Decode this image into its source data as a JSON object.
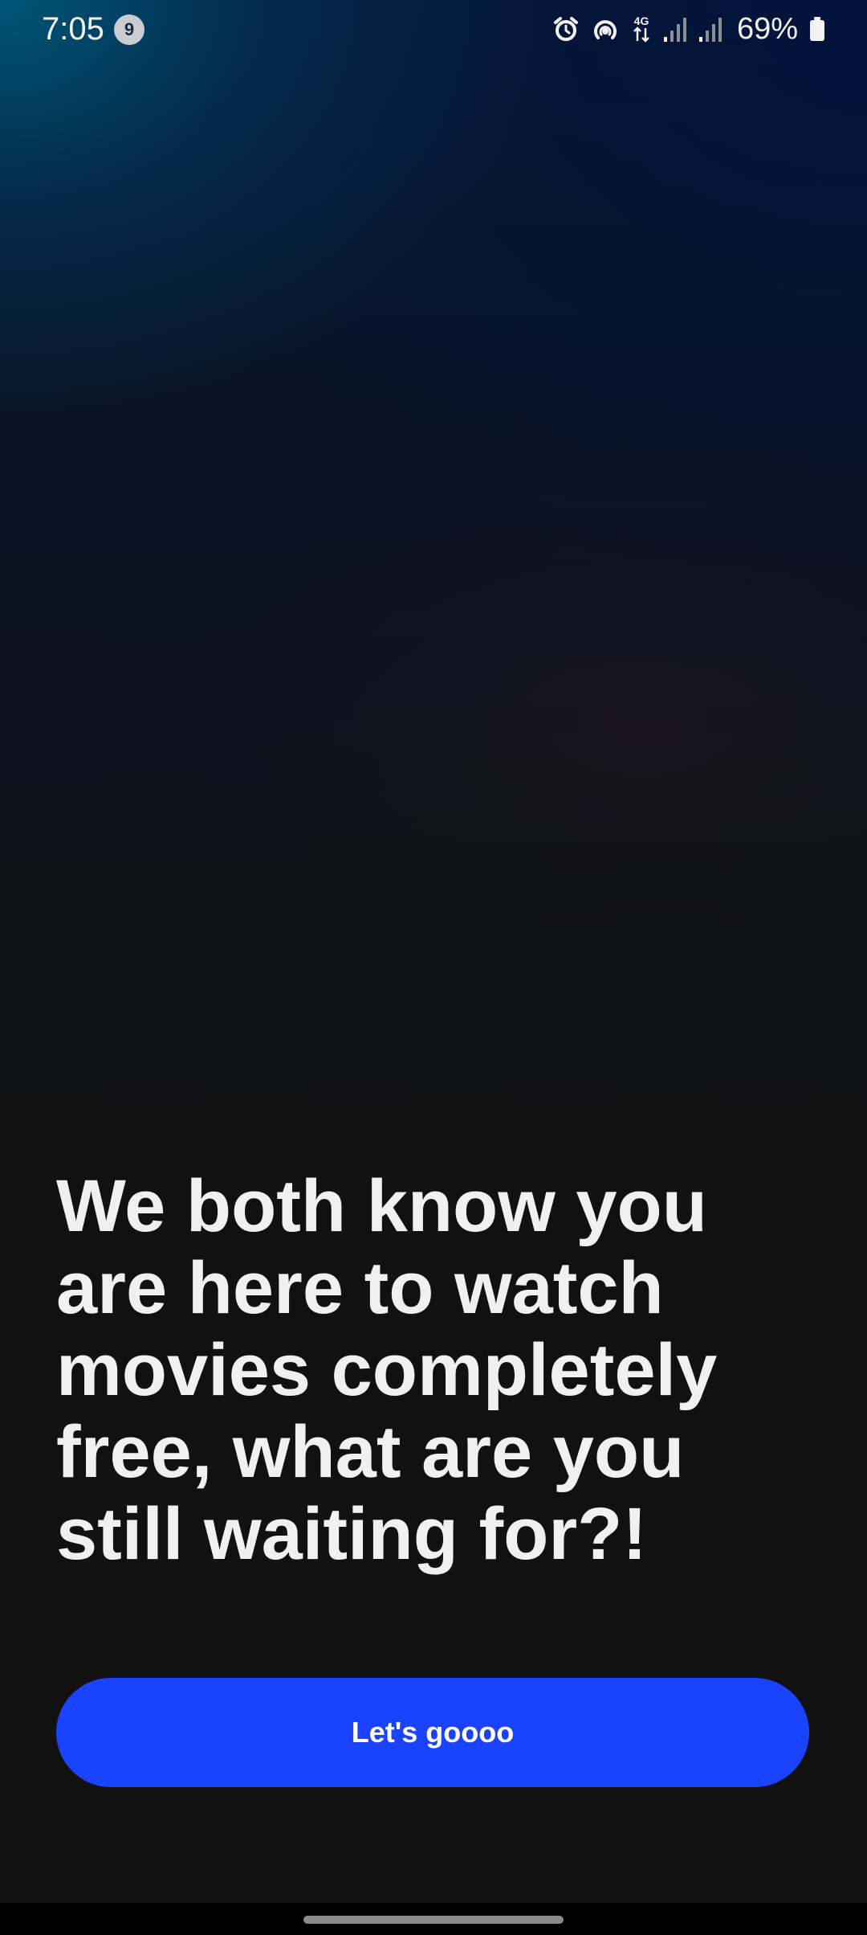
{
  "status_bar": {
    "time": "7:05",
    "notification_count": "9",
    "network_type": "4G",
    "battery": "69%",
    "icons": [
      "alarm-icon",
      "hotspot-icon",
      "data-arrows-icon",
      "signal-icon",
      "signal-icon",
      "battery-icon"
    ]
  },
  "main": {
    "headline": "We both know you are here to watch movies completely free, what are you still waiting for?!",
    "cta_label": "Let's goooo"
  },
  "colors": {
    "background": "#111112",
    "accent": "#1b43ff",
    "text": "#f0f0f0"
  }
}
